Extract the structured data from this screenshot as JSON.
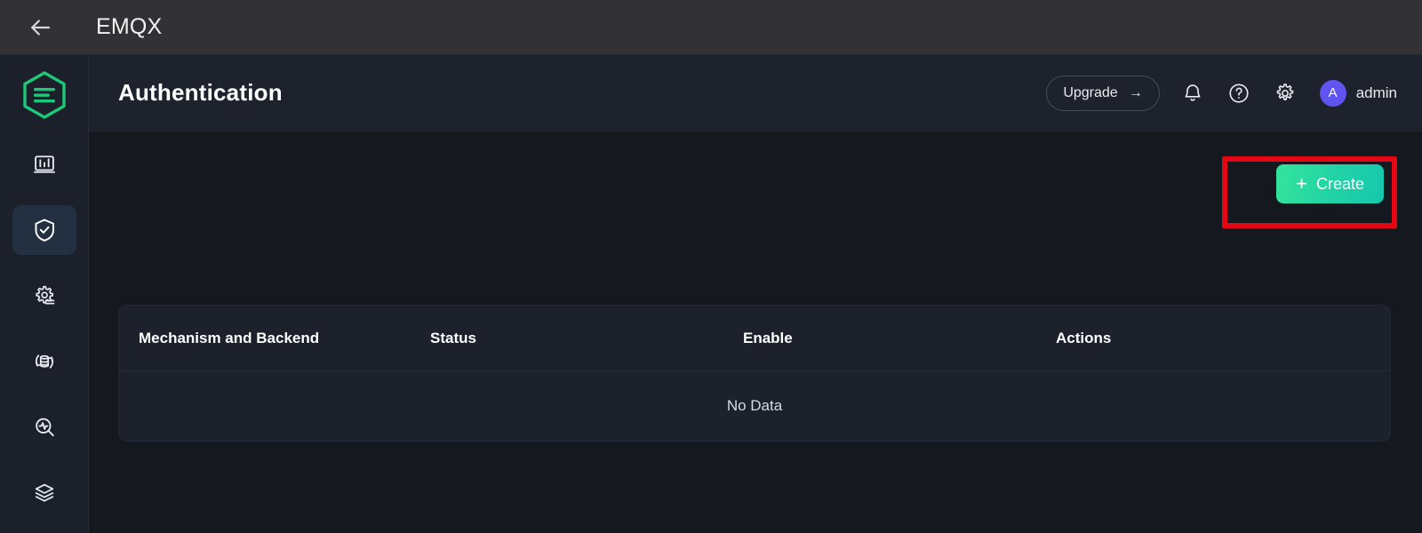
{
  "topbar": {
    "back_icon": "back-arrow-icon",
    "title": "EMQX"
  },
  "sidebar": {
    "logo": "emqx-logo-icon",
    "items": [
      {
        "name": "dashboard",
        "icon": "bar-chart-icon",
        "active": false
      },
      {
        "name": "access-control",
        "icon": "shield-check-icon",
        "active": true
      },
      {
        "name": "rules-engine",
        "icon": "gear-list-icon",
        "active": false
      },
      {
        "name": "data-integration",
        "icon": "database-sync-icon",
        "active": false
      },
      {
        "name": "diagnose",
        "icon": "magnifier-pulse-icon",
        "active": false
      },
      {
        "name": "management",
        "icon": "layers-stack-icon",
        "active": false
      }
    ]
  },
  "header": {
    "title": "Authentication",
    "upgrade_label": "Upgrade",
    "upgrade_arrow": "→",
    "bell_icon": "bell-icon",
    "help_icon": "question-circle-icon",
    "settings_icon": "gear-icon",
    "avatar_initial": "A",
    "user_name": "admin"
  },
  "toolbar": {
    "create_label": "Create",
    "create_plus": "+"
  },
  "table": {
    "columns": [
      "Mechanism and Backend",
      "Status",
      "Enable",
      "Actions"
    ],
    "empty_text": "No Data",
    "rows": []
  },
  "annotation": {
    "highlight_color": "#e30613",
    "target": "create-button"
  },
  "colors": {
    "accent_green": "#21d2a6",
    "logo_green": "#20c777",
    "avatar_purple": "#6054f0",
    "page_bg": "#15181f",
    "panel_bg": "#1c212c",
    "sidebar_bg": "#1b202a",
    "topbar_bg": "#323236"
  }
}
